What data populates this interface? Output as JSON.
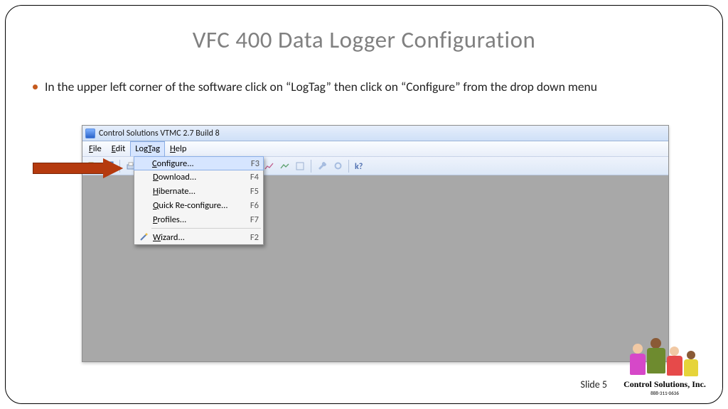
{
  "title": "VFC 400 Data Logger Configuration",
  "bullet": "In the upper left corner of the software click on “LogTag” then click on “Configure” from the drop down menu",
  "slide_label": "Slide 5",
  "brand": {
    "name": "Control Solutions, Inc.",
    "phone": "888-311-0636"
  },
  "app": {
    "window_title": "Control Solutions VTMC 2.7 Build 8",
    "menus": {
      "file": "File",
      "edit": "Edit",
      "logtag": "LogTag",
      "help": "Help"
    },
    "dropdown": {
      "configure": {
        "label": "Configure...",
        "shortcut": "F3"
      },
      "download": {
        "label": "Download...",
        "shortcut": "F4"
      },
      "hibernate": {
        "label": "Hibernate...",
        "shortcut": "F5"
      },
      "quick": {
        "label": "Quick Re-configure...",
        "shortcut": "F6"
      },
      "profiles": {
        "label": "Profiles...",
        "shortcut": "F7"
      },
      "wizard": {
        "label": "Wizard...",
        "shortcut": "F2"
      }
    }
  }
}
